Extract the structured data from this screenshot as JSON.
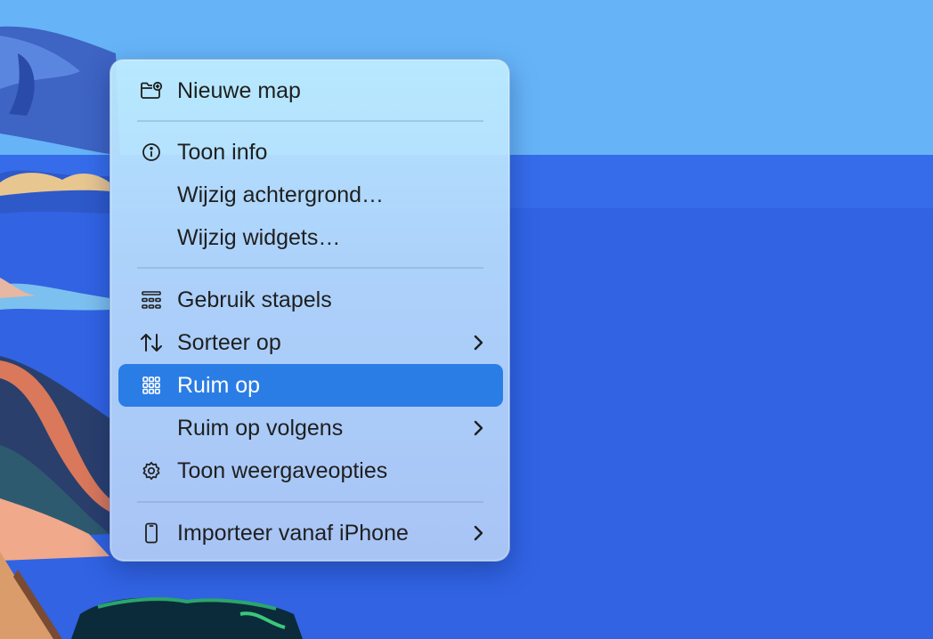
{
  "colors": {
    "sky": "#66b4f7",
    "water": "#2f5fe0",
    "menu_highlight": "#2b7de6"
  },
  "context_menu": {
    "items": [
      {
        "label": "Nieuwe map",
        "icon": "folder-plus-icon"
      },
      {
        "label": "Toon info",
        "icon": "info-circle-icon"
      },
      {
        "label": "Wijzig achtergrond…",
        "icon": ""
      },
      {
        "label": "Wijzig widgets…",
        "icon": ""
      },
      {
        "label": "Gebruik stapels",
        "icon": "stacks-icon"
      },
      {
        "label": "Sorteer op",
        "icon": "sort-arrows-icon",
        "submenu": true
      },
      {
        "label": "Ruim op",
        "icon": "grid-icon",
        "highlighted": true
      },
      {
        "label": "Ruim op volgens",
        "icon": "",
        "submenu": true
      },
      {
        "label": "Toon weergaveopties",
        "icon": "gear-icon"
      },
      {
        "label": "Importeer vanaf iPhone",
        "icon": "iphone-icon",
        "submenu": true
      }
    ]
  }
}
